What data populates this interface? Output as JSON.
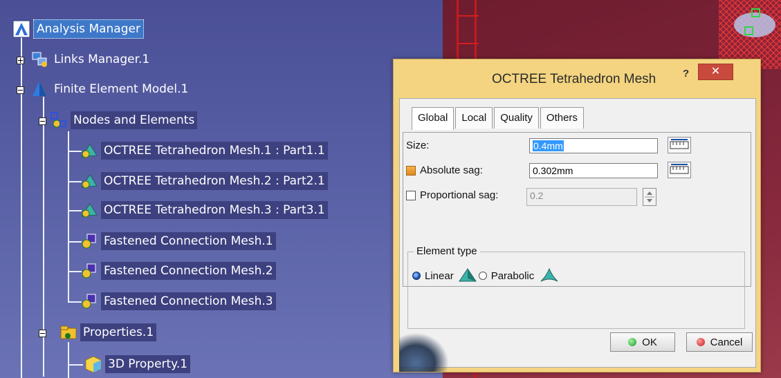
{
  "tree": {
    "root": "Analysis Manager",
    "links_manager": "Links Manager.1",
    "fem": "Finite Element Model.1",
    "nodes_elements": "Nodes and Elements",
    "children": [
      {
        "label": "OCTREE Tetrahedron Mesh.1 : Part1.1",
        "icon": "tetra-mesh-icon"
      },
      {
        "label": "OCTREE Tetrahedron Mesh.2 : Part2.1",
        "icon": "tetra-mesh-icon"
      },
      {
        "label": "OCTREE Tetrahedron Mesh.3 : Part3.1",
        "icon": "tetra-mesh-icon"
      },
      {
        "label": "Fastened Connection Mesh.1",
        "icon": "fastened-mesh-icon"
      },
      {
        "label": "Fastened Connection Mesh.2",
        "icon": "fastened-mesh-icon"
      },
      {
        "label": "Fastened Connection Mesh.3",
        "icon": "fastened-mesh-icon"
      }
    ],
    "properties": "Properties.1",
    "property_3d": "3D Property.1"
  },
  "dialog": {
    "title": "OCTREE Tetrahedron Mesh",
    "help": "?",
    "close": "✕",
    "tabs": [
      "Global",
      "Local",
      "Quality",
      "Others"
    ],
    "active_tab": "Global",
    "size_label": "Size:",
    "size_value": "0.4mm",
    "abs_sag_label": "Absolute sag:",
    "abs_sag_value": "0.302mm",
    "abs_sag_checked": true,
    "prop_sag_label": "Proportional sag:",
    "prop_sag_value": "0.2",
    "prop_sag_checked": false,
    "element_type_label": "Element type",
    "linear_label": "Linear",
    "parabolic_label": "Parabolic",
    "selected_element_type": "Linear",
    "ok_label": "OK",
    "cancel_label": "Cancel"
  },
  "colors": {
    "tree_background": "#585fa4",
    "label_highlight": "#3d4180",
    "dialog_frame": "#f4d480",
    "close_button": "#c84a3c",
    "viewport_part": "#7c2338",
    "mesh_edges": "#d21f1f"
  }
}
